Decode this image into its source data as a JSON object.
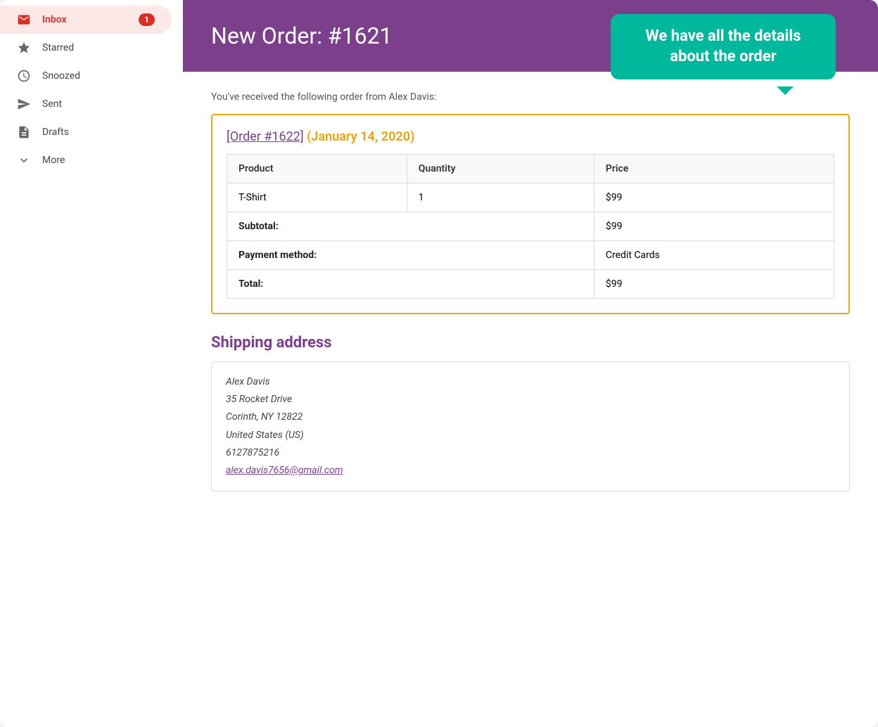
{
  "sidebar": {
    "items": [
      {
        "id": "inbox",
        "label": "Inbox",
        "icon": "inbox",
        "active": true,
        "badge": "1"
      },
      {
        "id": "starred",
        "label": "Starred",
        "icon": "star",
        "active": false,
        "badge": null
      },
      {
        "id": "snoozed",
        "label": "Snoozed",
        "icon": "clock",
        "active": false,
        "badge": null
      },
      {
        "id": "sent",
        "label": "Sent",
        "icon": "send",
        "active": false,
        "badge": null
      },
      {
        "id": "drafts",
        "label": "Drafts",
        "icon": "draft",
        "active": false,
        "badge": null
      },
      {
        "id": "more",
        "label": "More",
        "icon": "chevron-down",
        "active": false,
        "badge": null
      }
    ]
  },
  "email": {
    "header_title": "New Order: #1621",
    "tooltip_text": "We have all the details about the order",
    "from_line": "You've received the following order from Alex Davis:",
    "order_link_label": "[Order #1622]",
    "order_date": "(January 14, 2020)",
    "table": {
      "headers": [
        "Product",
        "Quantity",
        "Price"
      ],
      "rows": [
        {
          "product": "T-Shirt",
          "quantity": "1",
          "price": "$99"
        }
      ],
      "subtotal_label": "Subtotal:",
      "subtotal_value": "$99",
      "payment_label": "Payment method:",
      "payment_value": "Credit Cards",
      "total_label": "Total:",
      "total_value": "$99"
    },
    "shipping": {
      "title": "Shipping address",
      "name": "Alex Davis",
      "address1": "35 Rocket Drive",
      "address2": "Corinth, NY 12822",
      "country": "United States (US)",
      "phone": "6127875216",
      "email": "alex.davis7656@gmail.com"
    }
  },
  "colors": {
    "inbox_active_bg": "#fce8e6",
    "inbox_active_text": "#d93025",
    "header_bg": "#7b3f8c",
    "tooltip_bg": "#00b89c",
    "order_border": "#e6a817",
    "shipping_title": "#7b3f8c",
    "link_color": "#7b3f8c"
  }
}
